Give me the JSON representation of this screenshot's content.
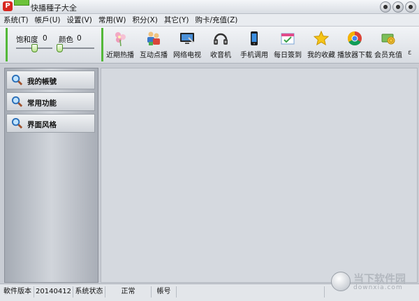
{
  "window": {
    "title": "快播種子大全",
    "app_icon": "P",
    "controls": [
      "●",
      "●",
      "●"
    ]
  },
  "menu": [
    "系统(T)",
    "帳戶(U)",
    "设置(V)",
    "常用(W)",
    "积分(X)",
    "其它(Y)",
    "购卡/充值(Z)"
  ],
  "sliders": {
    "saturation_label": "饱和度",
    "saturation_value": "0",
    "color_label": "颜色",
    "color_value": "0"
  },
  "toolbar": {
    "buttons": [
      {
        "label": "近期热播",
        "icon": "flower-icon"
      },
      {
        "label": "互动点播",
        "icon": "people-icon"
      },
      {
        "label": "网络电视",
        "icon": "tv-icon"
      },
      {
        "label": "收音机",
        "icon": "headphones-icon"
      },
      {
        "label": "手机调用",
        "icon": "phone-icon"
      },
      {
        "label": "每日簽到",
        "icon": "calendar-icon"
      },
      {
        "label": "我的收藏",
        "icon": "star-icon"
      },
      {
        "label": "播放器下载",
        "icon": "chrome-icon"
      },
      {
        "label": "会员充值",
        "icon": "coins-icon"
      }
    ],
    "more": "ε"
  },
  "sidebar": {
    "items": [
      {
        "label": "我的帳號"
      },
      {
        "label": "常用功能"
      },
      {
        "label": "界面风格"
      }
    ]
  },
  "statusbar": {
    "version_label": "軟件版本",
    "version_value": "20140412",
    "status_label": "系统状态",
    "status_value": "正常",
    "account_label": "帳号"
  },
  "watermark": {
    "text": "当下软件园",
    "sub": "downxia.com"
  },
  "colors": {
    "accent_green": "#54b83a",
    "app_red": "#d7261f"
  }
}
